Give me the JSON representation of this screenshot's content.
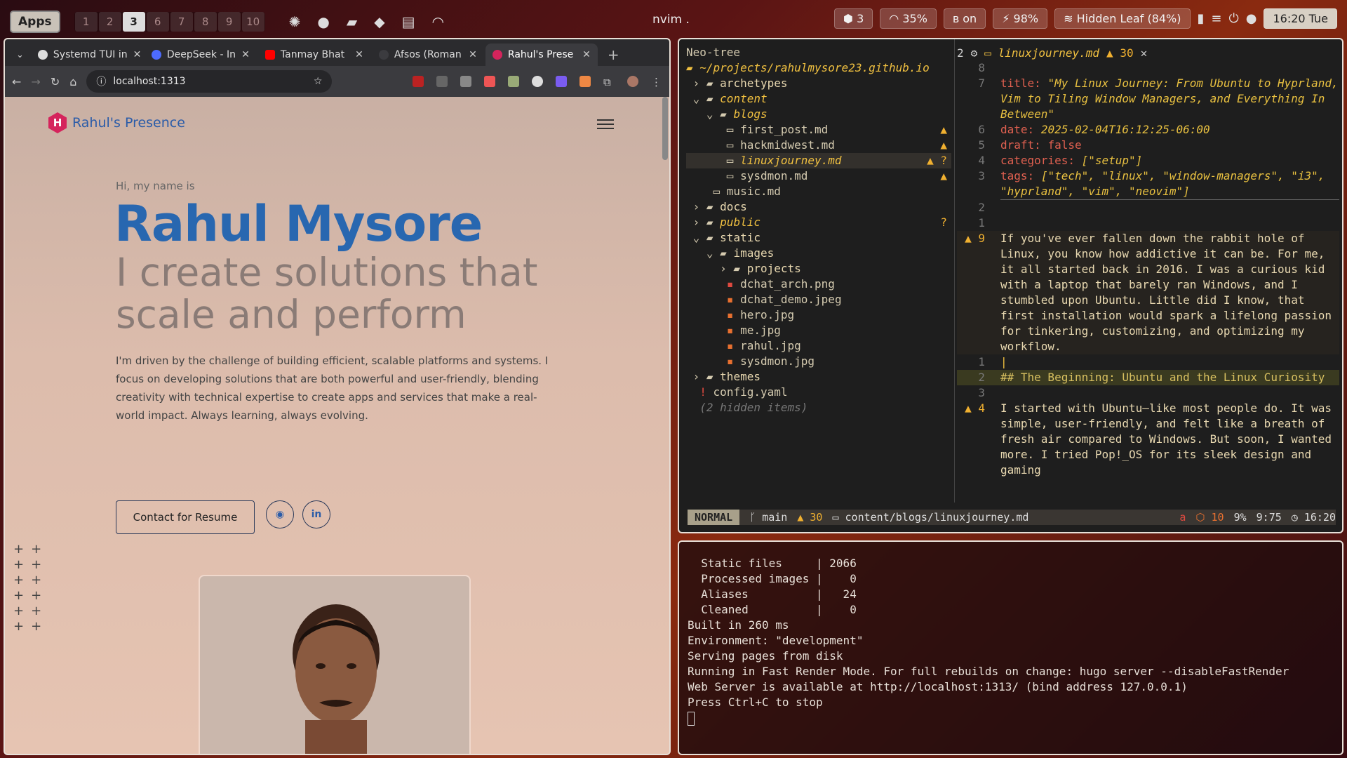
{
  "topbar": {
    "apps": "Apps",
    "workspaces": [
      "1",
      "2",
      "3",
      "6",
      "7",
      "8",
      "9",
      "10"
    ],
    "active_workspace": "3",
    "window_title": "nvim .",
    "status": {
      "updates": "3",
      "volume": "35%",
      "bluetooth": "on",
      "battery": "98%",
      "wifi": "Hidden Leaf (84%)",
      "clock": "16:20 Tue"
    }
  },
  "browser": {
    "tabs": [
      "Systemd TUI in",
      "DeepSeek - In",
      "Tanmay Bhat",
      "Afsos (Roman",
      "Rahul's Prese"
    ],
    "url": "localhost:1313",
    "site": {
      "logo": "Rahul's Presence",
      "greeting": "Hi, my name is",
      "name": "Rahul Mysore",
      "tagline": "I create solutions that scale and perform",
      "description": "I'm driven by the challenge of building efficient, scalable platforms and systems. I focus on developing solutions that are both powerful and user-friendly, blending creativity with technical expertise to create apps and services that make a real-world impact. Always learning, always evolving.",
      "cta": "Contact for Resume"
    }
  },
  "editor": {
    "tree_title": "Neo-tree",
    "tree_root": "~/projects/rahulmysore23.github.io",
    "tree": {
      "archetypes": "archetypes",
      "content": "content",
      "blogs": "blogs",
      "f1": "first_post.md",
      "f2": "hackmidwest.md",
      "f3": "linuxjourney.md",
      "f4": "sysdmon.md",
      "f5": "music.md",
      "docs": "docs",
      "public": "public",
      "static": "static",
      "images": "images",
      "projects": "projects",
      "i1": "dchat_arch.png",
      "i2": "dchat_demo.jpeg",
      "i3": "hero.jpg",
      "i4": "me.jpg",
      "i5": "rahul.jpg",
      "i6": "sysdmon.jpg",
      "themes": "themes",
      "config": "config.yaml",
      "hidden": "(2 hidden items)"
    },
    "buffer": {
      "num": "2",
      "file": "linuxjourney.md",
      "warnings": "30",
      "title_val": "\"My Linux Journey: From Ubuntu to Hyprland, Vim to Tiling Window Managers, and Everything In Between\"",
      "date_val": "2025-02-04T16:12:25-06:00",
      "draft_val": "false",
      "cat_val": "[\"setup\"]",
      "tags_val": "[\"tech\", \"linux\", \"window-managers\", \"i3\", \"hyprland\", \"vim\", \"neovim\"]",
      "para1": "If you've ever fallen down the rabbit hole of Linux, you know how addictive it can be. For me, it all started back in 2016. I was a curious kid with a laptop that barely ran Windows, and I stumbled upon Ubuntu. Little did I know, that first installation would spark a lifelong passion for tinkering, customizing, and optimizing my workflow.",
      "heading": "## The Beginning: Ubuntu and the Linux Curiosity",
      "para2": "I started with Ubuntu—like most people do. It was simple, user-friendly, and felt like a breath of fresh air compared to Windows. But soon, I wanted more. I tried Pop!_OS for its sleek design and gaming"
    },
    "statusline": {
      "mode": "NORMAL",
      "branch": "main",
      "warn": "30",
      "path": "content/blogs/linuxjourney.md",
      "a": "a",
      "diag": "10",
      "pct": "9%",
      "pos": "9:75",
      "time": "16:20"
    }
  },
  "terminal": {
    "lines": [
      "  Static files     | 2066",
      "  Processed images |    0",
      "  Aliases          |   24",
      "  Cleaned          |    0",
      "",
      "Built in 260 ms",
      "Environment: \"development\"",
      "Serving pages from disk",
      "Running in Fast Render Mode. For full rebuilds on change: hugo server --disableFastRender",
      "Web Server is available at http://localhost:1313/ (bind address 127.0.0.1)",
      "Press Ctrl+C to stop"
    ]
  }
}
